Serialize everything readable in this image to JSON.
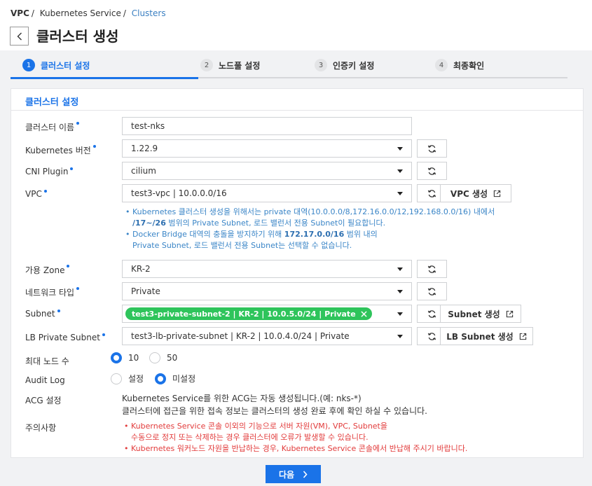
{
  "breadcrumb": {
    "root": "VPC",
    "section": "Kubernetes Service",
    "current": "Clusters"
  },
  "page_title": "클러스터 생성",
  "steps": [
    {
      "num": "1",
      "label": "클러스터 설정"
    },
    {
      "num": "2",
      "label": "노드풀 설정"
    },
    {
      "num": "3",
      "label": "인증키 설정"
    },
    {
      "num": "4",
      "label": "최종확인"
    }
  ],
  "card_title": "클러스터 설정",
  "labels": {
    "cluster_name": "클러스터 이름",
    "k8s_version": "Kubernetes 버전",
    "cni": "CNI Plugin",
    "vpc": "VPC",
    "zone": "가용 Zone",
    "network_type": "네트워크 타입",
    "subnet": "Subnet",
    "lb_subnet": "LB Private Subnet",
    "max_nodes": "최대 노드 수",
    "audit": "Audit Log",
    "acg": "ACG 설정",
    "notice": "주의사항"
  },
  "values": {
    "cluster_name": "test-nks",
    "k8s_version": "1.22.9",
    "cni": "cilium",
    "vpc": "test3-vpc | 10.0.0.0/16",
    "zone": "KR-2",
    "network_type": "Private",
    "subnet_tag": "test3-private-subnet-2 | KR-2 | 10.0.5.0/24 | Private",
    "lb_subnet": "test3-lb-private-subnet | KR-2 | 10.0.4.0/24 | Private"
  },
  "buttons": {
    "vpc_create": "VPC 생성",
    "subnet_create": "Subnet 생성",
    "lb_subnet_create": "LB Subnet 생성",
    "next": "다음"
  },
  "vpc_info": {
    "line1": "Kubernetes 클러스터 생성을 위해서는 private 대역(10.0.0.0/8,172.16.0.0/12,192.168.0.0/16) 내에서",
    "line2_bold": "/17~/26",
    "line2_rest": " 범위의 Private Subnet, 로드 밸런서 전용 Subnet이 필요합니다.",
    "line3_pre": "Docker Bridge 대역의 충돌을 방지하기 위해 ",
    "line3_bold": "172.17.0.0/16",
    "line3_post": " 범위 내의",
    "line4": "Private Subnet, 로드 밸런서 전용 Subnet는 선택할 수 없습니다."
  },
  "max_nodes": {
    "option1": "10",
    "option2": "50",
    "selected": "10"
  },
  "audit": {
    "option1": "설정",
    "option2": "미설정",
    "selected": "미설정"
  },
  "acg_text": {
    "line1": "Kubernetes Service를 위한 ACG는 자동 생성됩니다.(예: nks-*)",
    "line2": "클러스터에 접근을 위한 접속 정보는 클러스터의 생성 완료 후에 확인 하실 수 있습니다."
  },
  "notice_text": {
    "line1": "Kubernetes Service 콘솔 이외의 기능으로 서버 자원(VM), VPC, Subnet을",
    "line2": "수동으로 정지 또는 삭제하는 경우 클러스터에 오류가 발생할 수 있습니다.",
    "line3": "Kubernetes 워커노드 자원을 반납하는 경우, Kubernetes Service 콘솔에서 반납해 주시기 바랍니다."
  },
  "icons": {
    "back": "chevron-left-icon",
    "refresh": "refresh-icon",
    "external": "external-link-icon",
    "next": "chevron-right-icon",
    "tag_remove": "close-icon"
  },
  "colors": {
    "accent": "#1a73e8",
    "tag": "#2ec45b",
    "info": "#3a85c7",
    "warning": "#e23b3b"
  }
}
